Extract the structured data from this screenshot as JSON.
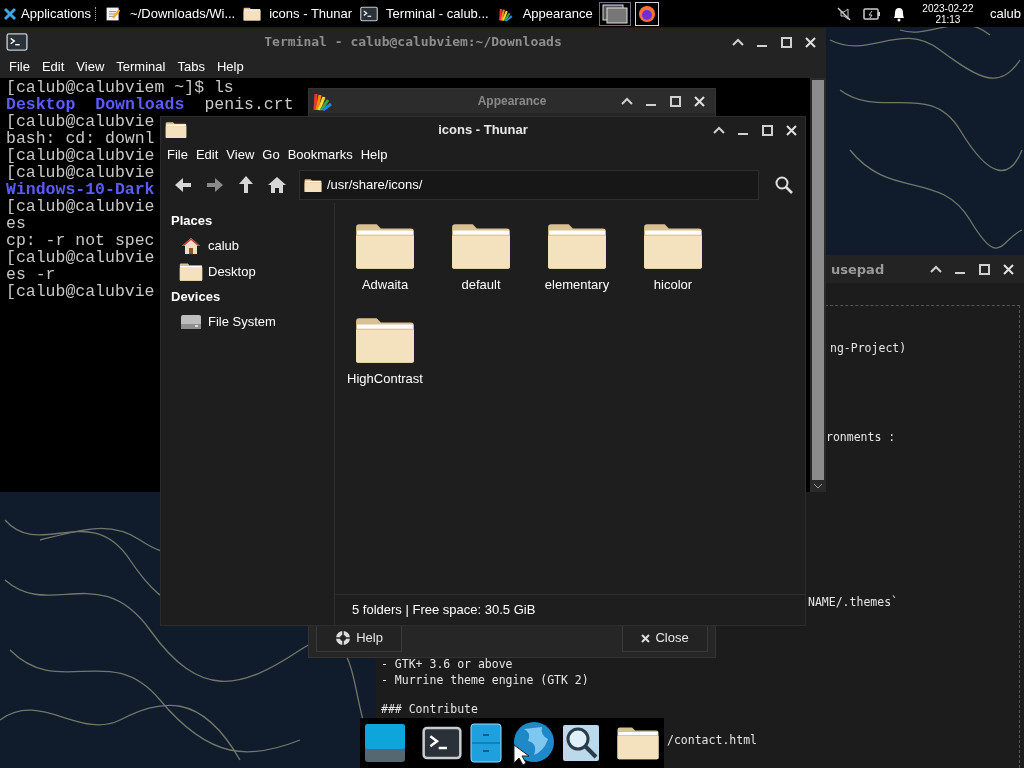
{
  "top_panel": {
    "applications_label": "Applications",
    "tasks": [
      {
        "kind": "editor",
        "label": "~/Downloads/Wi..."
      },
      {
        "kind": "folder",
        "label": "icons - Thunar"
      },
      {
        "kind": "terminal",
        "label": "Terminal - calub..."
      },
      {
        "kind": "appearance",
        "label": "Appearance"
      }
    ],
    "date": "2023-02-22",
    "time": "21:13",
    "user": "calub"
  },
  "mousepad": {
    "title": "usepad",
    "lines": [
      {
        "text": "ng-Project)"
      },
      {
        "text": "ronments :"
      },
      {
        "text": "NAME/.themes`"
      },
      {
        "text": "- GTK+ 3.6 or above"
      },
      {
        "text": "- Murrine theme engine (GTK 2)"
      },
      {
        "text": "### Contribute"
      },
      {
        "text": "/contact.html"
      }
    ]
  },
  "terminal": {
    "title": "Terminal - calub@calubviem:~/Downloads",
    "menu": [
      "File",
      "Edit",
      "View",
      "Terminal",
      "Tabs",
      "Help"
    ],
    "lines": [
      [
        {
          "text": "[calub@calubviem ~]$ ls",
          "kind": "plain"
        }
      ],
      [
        {
          "text": "Desktop",
          "kind": "directory"
        },
        {
          "text": "Downloads",
          "kind": "directory"
        },
        {
          "text": "penis.crt",
          "kind": "plain"
        }
      ],
      [
        {
          "text": "[calub@calubvie",
          "kind": "plain"
        }
      ],
      [
        {
          "text": "bash: cd: downl",
          "kind": "plain"
        }
      ],
      [
        {
          "text": "[calub@calubvie",
          "kind": "plain"
        }
      ],
      [
        {
          "text": "[calub@calubvie",
          "kind": "plain"
        }
      ],
      [
        {
          "text": "Windows-10-Dark",
          "kind": "directory"
        }
      ],
      [
        {
          "text": "[calub@calubvie",
          "kind": "plain"
        }
      ],
      [
        {
          "text": "es",
          "kind": "plain"
        }
      ],
      [
        {
          "text": "cp: -r not spec",
          "kind": "plain"
        }
      ],
      [
        {
          "text": "[calub@calubvie",
          "kind": "plain"
        }
      ],
      [
        {
          "text": "es -r",
          "kind": "plain"
        }
      ],
      [
        {
          "text": "[calub@calubvie",
          "kind": "plain"
        }
      ]
    ]
  },
  "appearance": {
    "title": "Appearance",
    "buttons": [
      {
        "kind": "help",
        "label": "Help"
      },
      {
        "kind": "close",
        "label": "Close"
      }
    ]
  },
  "thunar": {
    "title": "icons - Thunar",
    "menu": [
      "File",
      "Edit",
      "View",
      "Go",
      "Bookmarks",
      "Help"
    ],
    "path": "/usr/share/icons/",
    "sidebar": [
      {
        "heading": "Places",
        "items": [
          {
            "kind": "home",
            "label": "calub"
          },
          {
            "kind": "folder",
            "label": "Desktop"
          }
        ]
      },
      {
        "heading": "Devices",
        "items": [
          {
            "kind": "drive",
            "label": "File System"
          }
        ]
      }
    ],
    "folders": [
      "Adwaita",
      "default",
      "elementary",
      "hicolor",
      "HighContrast"
    ],
    "status": "5 folders | Free space: 30.5 GiB"
  },
  "dock": {
    "items": [
      {
        "kind": "show-desktop"
      },
      {
        "kind": "separator"
      },
      {
        "kind": "terminal"
      },
      {
        "kind": "file-cabinet"
      },
      {
        "kind": "web-browser"
      },
      {
        "kind": "app-finder"
      },
      {
        "kind": "separator"
      },
      {
        "kind": "folder"
      }
    ]
  }
}
